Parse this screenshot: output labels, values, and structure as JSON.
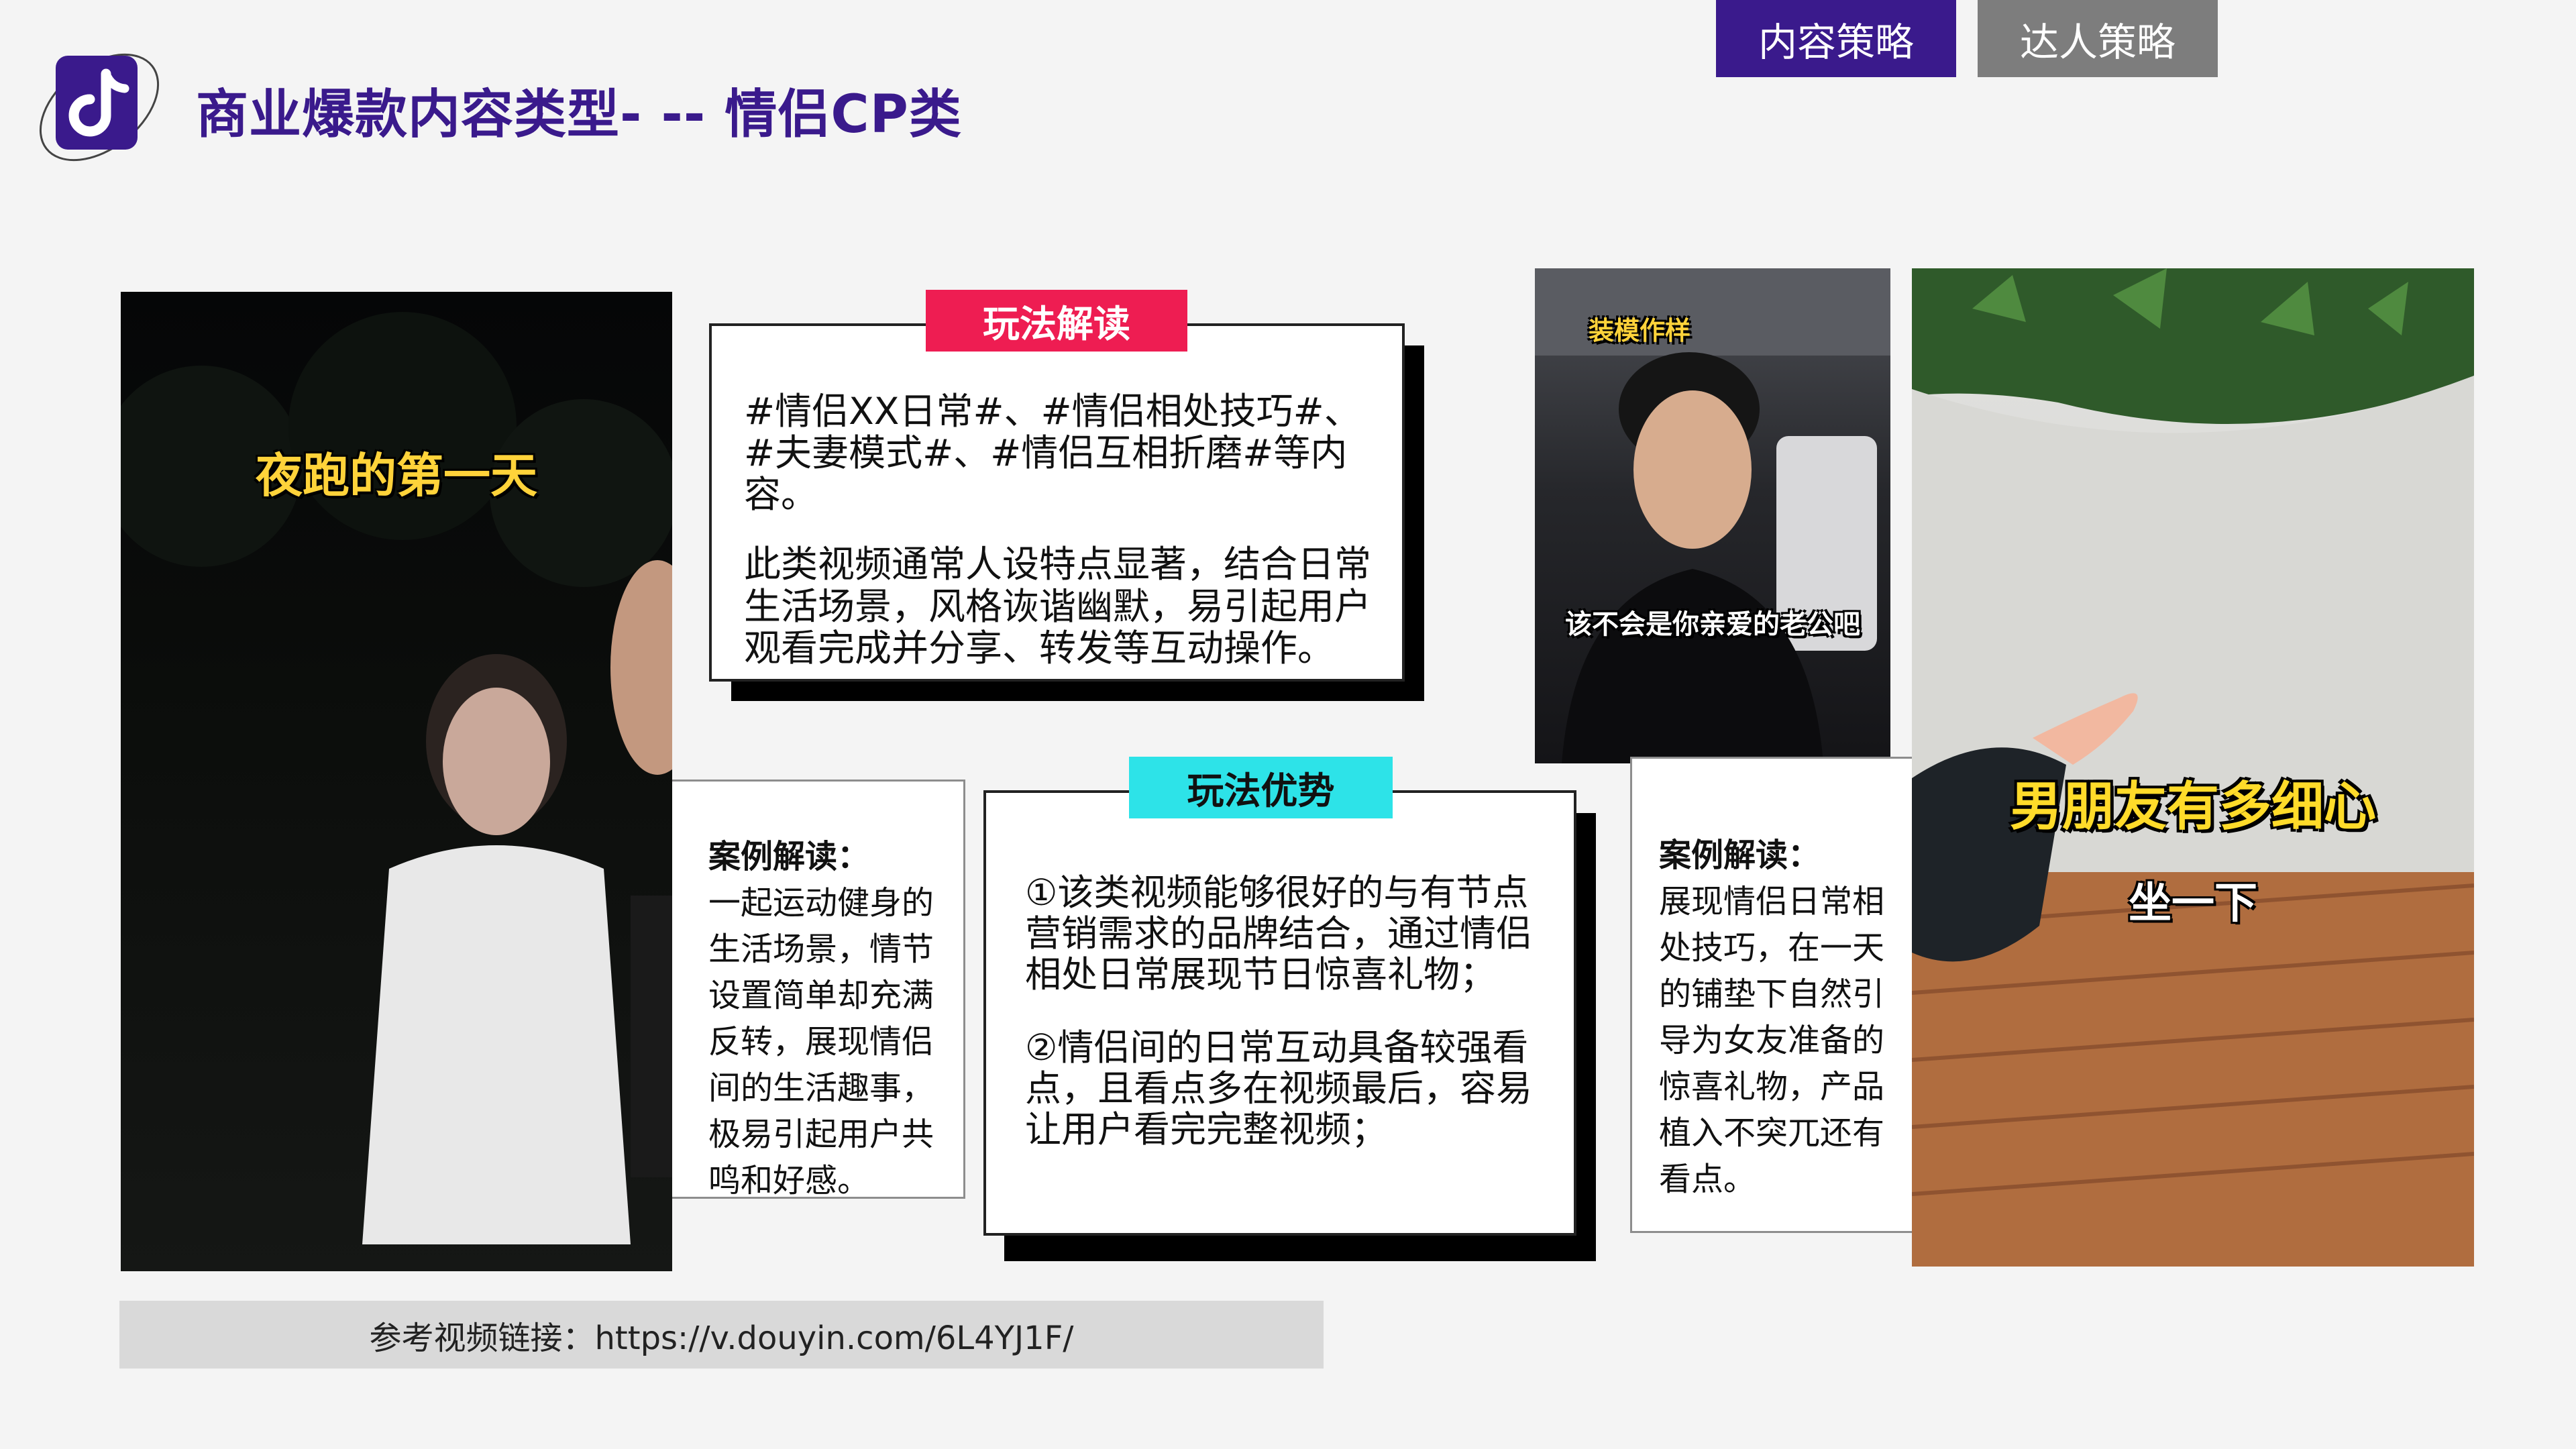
{
  "header": {
    "title": "商业爆款内容类型- -- 情侣CP类",
    "tabs": [
      {
        "label": "内容策略",
        "active": true,
        "color": "#3a1a8c"
      },
      {
        "label": "达人策略",
        "active": false,
        "color": "#7d7d7d"
      }
    ],
    "logo_icon": "douyin-logo-icon"
  },
  "photos": {
    "left_caption": "夜跑的第一天",
    "middle_caption_top": "装模作样",
    "middle_caption_bottom": "该不会是你亲爱的老公吧",
    "right_caption_main": "男朋友有多细心",
    "right_caption_sub": "坐一下"
  },
  "gameplay_reading": {
    "label": "玩法解读",
    "paragraph1": "#情侣XX日常#、#情侣相处技巧#、#夫妻模式#、#情侣互相折磨#等内容。",
    "paragraph2": "此类视频通常人设特点显著，结合日常生活场景，风格诙谐幽默，易引起用户观看完成并分享、转发等互动操作。"
  },
  "gameplay_advantage": {
    "label": "玩法优势",
    "point1": "①该类视频能够很好的与有节点营销需求的品牌结合，通过情侣相处日常展现节日惊喜礼物；",
    "point2": "②情侣间的日常互动具备较强看点，且看点多在视频最后，容易让用户看完完整视频；"
  },
  "case_left": {
    "title": "案例解读：",
    "body": "一起运动健身的生活场景，情节设置简单却充满反转，展现情侣间的生活趣事，极易引起用户共鸣和好感。"
  },
  "case_right": {
    "title": "案例解读：",
    "body": "展现情侣日常相处技巧，在一天的铺垫下自然引导为女友准备的惊喜礼物，产品植入不突兀还有看点。"
  },
  "reference_link": "参考视频链接：https://v.douyin.com/6L4YJ1F/",
  "colors": {
    "brand_purple": "#3a1a8c",
    "label_pink": "#ee1d52",
    "label_cyan": "#2de3e8"
  }
}
